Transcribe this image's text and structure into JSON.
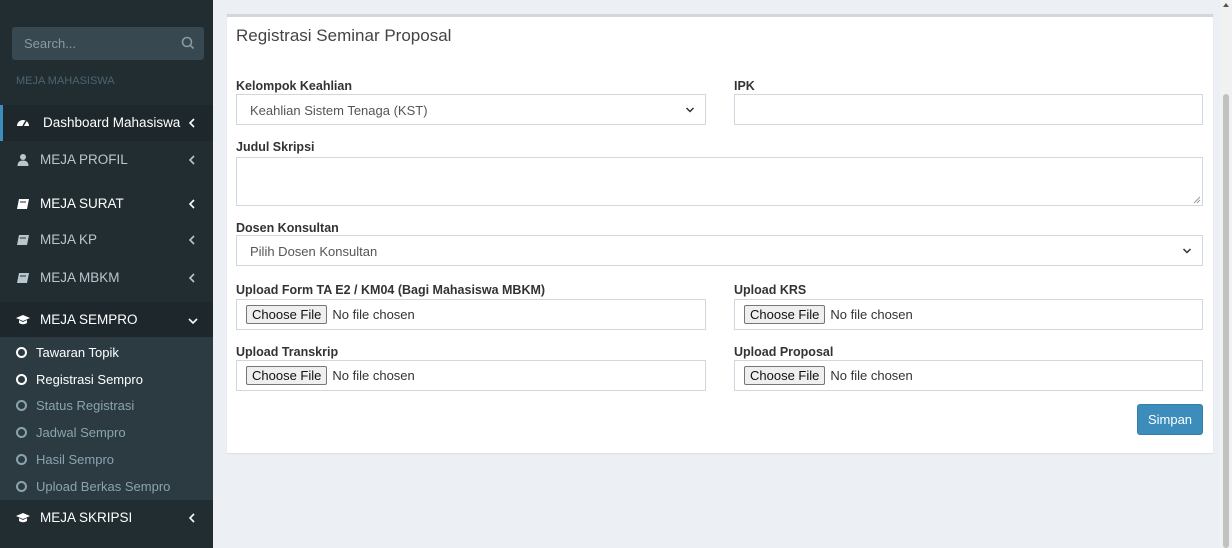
{
  "sidebar": {
    "search_placeholder": "Search...",
    "section_header": "MEJA MAHASISWA",
    "items": [
      {
        "label": "Dashboard Mahasiswa",
        "icon": "dashboard-icon"
      },
      {
        "label": "MEJA PROFIL",
        "icon": "user-icon"
      },
      {
        "label": "MEJA SURAT",
        "icon": "book-icon"
      },
      {
        "label": "MEJA KP",
        "icon": "book-icon"
      },
      {
        "label": "MEJA MBKM",
        "icon": "book-icon"
      },
      {
        "label": "MEJA SEMPRO",
        "icon": "graduation-cap-icon"
      },
      {
        "label": "MEJA SKRIPSI",
        "icon": "graduation-cap-icon"
      }
    ],
    "submenu": [
      {
        "label": "Tawaran Topik"
      },
      {
        "label": "Registrasi Sempro"
      },
      {
        "label": "Status Registrasi"
      },
      {
        "label": "Jadwal Sempro"
      },
      {
        "label": "Hasil Sempro"
      },
      {
        "label": "Upload Berkas Sempro"
      }
    ]
  },
  "form": {
    "title": "Registrasi Seminar Proposal",
    "kelompok_label": "Kelompok Keahlian",
    "kelompok_value": "Keahlian Sistem Tenaga (KST)",
    "ipk_label": "IPK",
    "ipk_value": "",
    "judul_label": "Judul Skripsi",
    "judul_value": "",
    "dosen_label": "Dosen Konsultan",
    "dosen_value": "Pilih Dosen Konsultan",
    "upload_form_label": "Upload Form TA E2 / KM04 (Bagi Mahasiswa MBKM)",
    "upload_krs_label": "Upload KRS",
    "upload_transkrip_label": "Upload Transkrip",
    "upload_proposal_label": "Upload Proposal",
    "choose_file": "Choose File",
    "no_file": "No file chosen",
    "submit_label": "Simpan"
  },
  "colors": {
    "sidebar_bg": "#222d32",
    "accent": "#3c8dbc",
    "page_bg": "#ecf0f5"
  }
}
